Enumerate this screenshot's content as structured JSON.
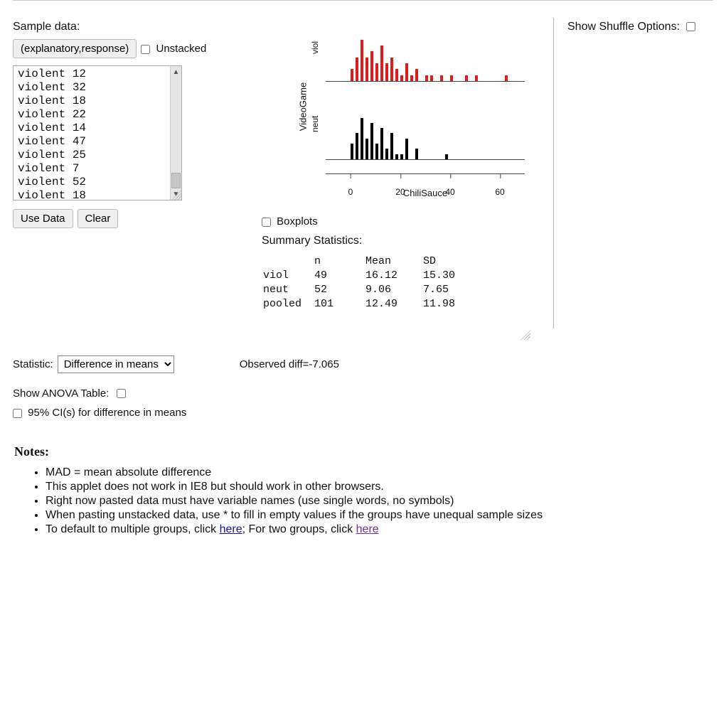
{
  "sample_data": {
    "label": "Sample data:",
    "format_button": "(explanatory,response)",
    "unstacked_label": "Unstacked",
    "rows": [
      "violent 12",
      "violent 32",
      "violent 18",
      "violent 22",
      "violent 14",
      "violent 47",
      "violent 25",
      "violent 7",
      "violent 52",
      "violent 18"
    ],
    "use_data_btn": "Use Data",
    "clear_btn": "Clear"
  },
  "right": {
    "shuffle_label": "Show Shuffle Options:"
  },
  "chart_controls": {
    "boxplots_label": "Boxplots",
    "summary_label": "Summary Statistics:"
  },
  "summary": {
    "headers": [
      "",
      "n",
      "Mean",
      "SD"
    ],
    "rows": [
      {
        "label": "viol",
        "n": 49,
        "mean": "16.12",
        "sd": "15.30"
      },
      {
        "label": "neut",
        "n": 52,
        "mean": "9.06",
        "sd": "7.65"
      },
      {
        "label": "pooled",
        "n": 101,
        "mean": "12.49",
        "sd": "11.98"
      }
    ]
  },
  "statistic": {
    "label": "Statistic:",
    "selected": "Difference in means",
    "options": [
      "Difference in means"
    ],
    "observed_label": "Observed diff=-7.065"
  },
  "anova": {
    "label": "Show ANOVA Table:",
    "ci_label": "95% CI(s) for difference in means"
  },
  "notes": {
    "heading": "Notes",
    "items": [
      "MAD = mean absolute difference",
      "This applet does not work in IE8 but should work in other browsers.",
      "Right now pasted data must have variable names (use single words, no symbols)",
      "When pasting unstacked data, use * to fill in empty values if the groups have unequal sample sizes",
      "To default to multiple groups, click "
    ],
    "link1": "here",
    "between": "; For two groups, click ",
    "link2": "here"
  },
  "chart_data": {
    "type": "bar",
    "title": "",
    "xlabel": "ChiliSauce",
    "ylabel": "VideoGame",
    "x_ticks": [
      0,
      20,
      40,
      60
    ],
    "xlim": [
      -10,
      70
    ],
    "ylim": [
      0,
      8
    ],
    "series": [
      {
        "name": "viol",
        "color": "#e01b1b",
        "bins": [
          {
            "x": 0,
            "count": 2
          },
          {
            "x": 2,
            "count": 4
          },
          {
            "x": 4,
            "count": 7
          },
          {
            "x": 6,
            "count": 4
          },
          {
            "x": 8,
            "count": 5
          },
          {
            "x": 10,
            "count": 3
          },
          {
            "x": 12,
            "count": 6
          },
          {
            "x": 14,
            "count": 3
          },
          {
            "x": 16,
            "count": 4
          },
          {
            "x": 18,
            "count": 2
          },
          {
            "x": 20,
            "count": 1
          },
          {
            "x": 22,
            "count": 3
          },
          {
            "x": 24,
            "count": 1
          },
          {
            "x": 26,
            "count": 2
          },
          {
            "x": 28,
            "count": 0
          },
          {
            "x": 30,
            "count": 1
          },
          {
            "x": 32,
            "count": 1
          },
          {
            "x": 34,
            "count": 0
          },
          {
            "x": 36,
            "count": 1
          },
          {
            "x": 38,
            "count": 0
          },
          {
            "x": 40,
            "count": 1
          },
          {
            "x": 44,
            "count": 0
          },
          {
            "x": 46,
            "count": 1
          },
          {
            "x": 50,
            "count": 1
          },
          {
            "x": 62,
            "count": 1
          }
        ]
      },
      {
        "name": "neut",
        "color": "#000000",
        "bins": [
          {
            "x": 0,
            "count": 3
          },
          {
            "x": 2,
            "count": 5
          },
          {
            "x": 4,
            "count": 8
          },
          {
            "x": 6,
            "count": 4
          },
          {
            "x": 8,
            "count": 7
          },
          {
            "x": 10,
            "count": 3
          },
          {
            "x": 12,
            "count": 6
          },
          {
            "x": 14,
            "count": 2
          },
          {
            "x": 16,
            "count": 5
          },
          {
            "x": 18,
            "count": 1
          },
          {
            "x": 20,
            "count": 1
          },
          {
            "x": 22,
            "count": 4
          },
          {
            "x": 24,
            "count": 0
          },
          {
            "x": 26,
            "count": 2
          },
          {
            "x": 38,
            "count": 1
          }
        ]
      }
    ]
  }
}
